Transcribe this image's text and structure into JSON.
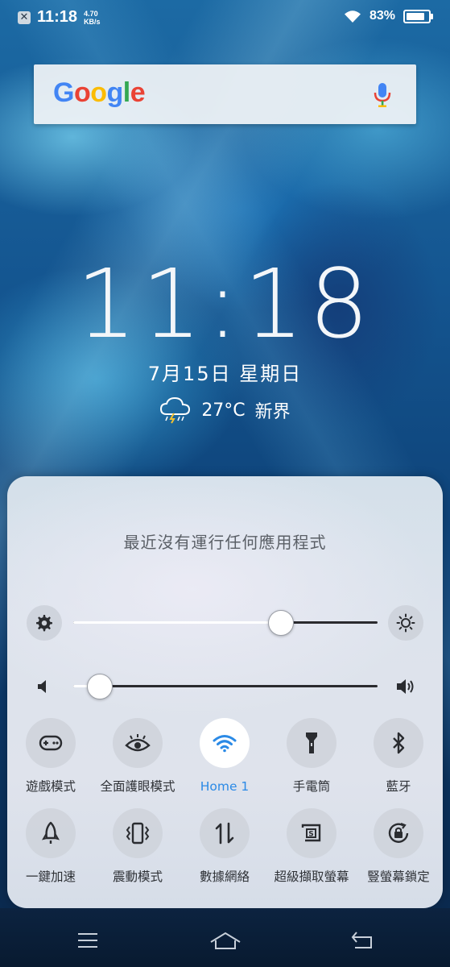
{
  "status_bar": {
    "time": "11:18",
    "net_speed_value": "4.70",
    "net_speed_unit": "KB/s",
    "battery_percent": "83%",
    "battery_level": 0.83,
    "icons": [
      "notification-x-icon",
      "wifi-icon",
      "battery-icon"
    ]
  },
  "search_widget": {
    "logo_letters": [
      "G",
      "o",
      "o",
      "g",
      "l",
      "e"
    ],
    "logo_colors": [
      "#4285F4",
      "#EA4335",
      "#FBBC05",
      "#4285F4",
      "#34A853",
      "#EA4335"
    ],
    "mic_icon": "mic-icon"
  },
  "lockscreen": {
    "clock": "11:18",
    "date": "7月15日  星期日",
    "weather_icon": "thunderstorm-cloud-icon",
    "temperature": "27°C",
    "location": "新界"
  },
  "control_center": {
    "message": "最近沒有運行任何應用程式",
    "brightness": {
      "level": 0.68,
      "left_icon": "gear-icon",
      "right_icon": "brightness-sun-icon"
    },
    "volume": {
      "level": 0.085,
      "left_icon": "speaker-low-icon",
      "right_icon": "speaker-high-icon"
    },
    "tiles": [
      {
        "label": "遊戲模式",
        "icon": "gamepad-icon",
        "active": false
      },
      {
        "label": "全面護眼模式",
        "icon": "eye-icon",
        "active": false
      },
      {
        "label": "Home 1",
        "icon": "wifi-icon",
        "active": true
      },
      {
        "label": "手電筒",
        "icon": "flashlight-icon",
        "active": false
      },
      {
        "label": "藍牙",
        "icon": "bluetooth-icon",
        "active": false
      },
      {
        "label": "一鍵加速",
        "icon": "rocket-icon",
        "active": false
      },
      {
        "label": "震動模式",
        "icon": "vibrate-icon",
        "active": false
      },
      {
        "label": "數據網絡",
        "icon": "data-arrows-icon",
        "active": false
      },
      {
        "label": "超級擷取螢幕",
        "icon": "screenshot-icon",
        "active": false
      },
      {
        "label": "豎螢幕鎖定",
        "icon": "rotation-lock-icon",
        "active": false
      }
    ],
    "accent_color": "#2b8ae6"
  },
  "nav_bar": {
    "icons": [
      "menu-icon",
      "home-icon",
      "back-icon"
    ]
  }
}
